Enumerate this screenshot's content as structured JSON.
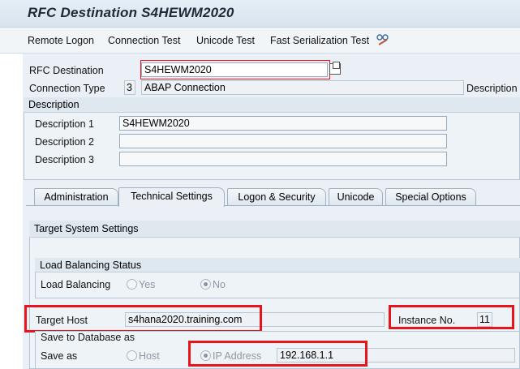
{
  "window": {
    "title": "RFC Destination S4HEWM2020"
  },
  "toolbar": {
    "buttons": [
      "Remote Logon",
      "Connection Test",
      "Unicode Test",
      "Fast Serialization Test"
    ],
    "icon": "glasses-icon"
  },
  "header": {
    "rfc_destination_label": "RFC Destination",
    "rfc_destination_value": "S4HEWM2020",
    "connection_type_label": "Connection Type",
    "connection_type_code": "3",
    "connection_type_value": "ABAP Connection",
    "description_label": "Description"
  },
  "description": {
    "section_title": "Description",
    "d1_label": "Description 1",
    "d1_value": "S4HEWM2020",
    "d2_label": "Description 2",
    "d2_value": "",
    "d3_label": "Description 3",
    "d3_value": ""
  },
  "tabs": [
    {
      "label": "Administration",
      "active": false
    },
    {
      "label": "Technical Settings",
      "active": true
    },
    {
      "label": "Logon & Security",
      "active": false
    },
    {
      "label": "Unicode",
      "active": false
    },
    {
      "label": "Special Options",
      "active": false
    }
  ],
  "technical": {
    "target_system_title": "Target System Settings",
    "load_balancing_title": "Load Balancing Status",
    "load_balancing_label": "Load Balancing",
    "lb_yes": "Yes",
    "lb_no": "No",
    "target_host_label": "Target Host",
    "target_host_value": "s4hana2020.training.com",
    "instance_label": "Instance No.",
    "instance_value": "11",
    "save_db_title": "Save to Database as",
    "save_as_label": "Save as",
    "save_host": "Host",
    "save_ip": "IP Address",
    "ip_value": "192.168.1.1"
  },
  "colors": {
    "highlight": "#e8141c",
    "title_bg": "#e6eef6"
  }
}
